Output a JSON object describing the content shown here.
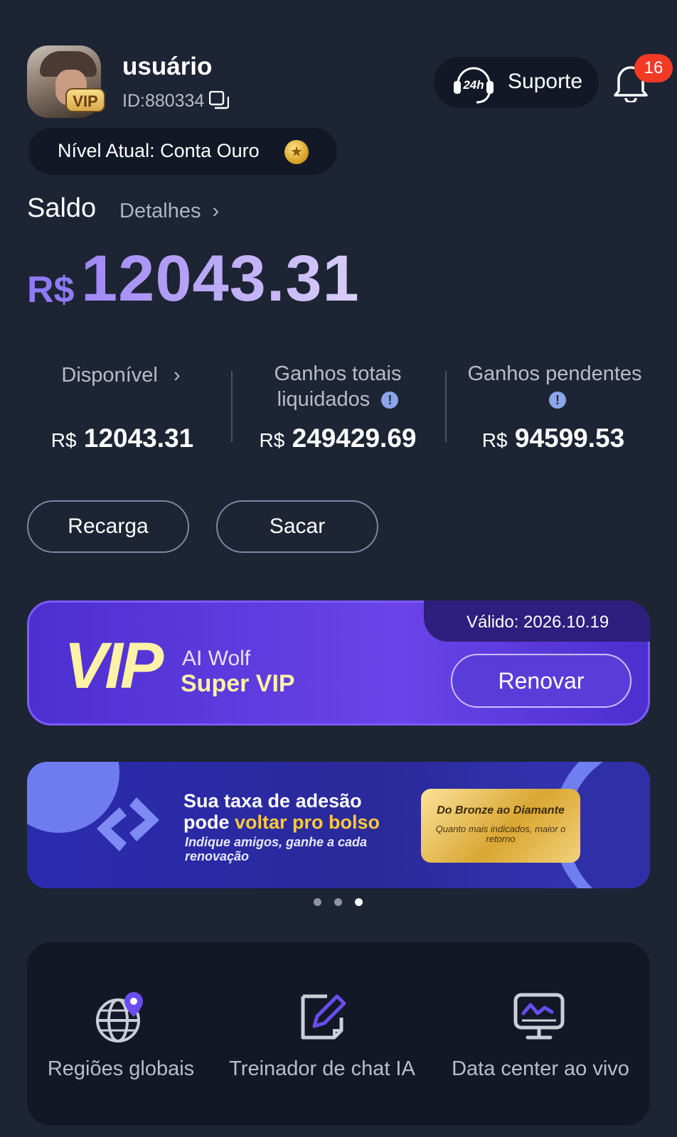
{
  "header": {
    "username": "usuário",
    "user_id": "ID:880334",
    "vip_badge": "VIP",
    "support_label": "Suporte",
    "support_icon_text": "24h",
    "notification_count": "16",
    "level_text": "Nível Atual:  Conta Ouro"
  },
  "balance": {
    "title": "Saldo",
    "details_link": "Detalhes",
    "currency": "R$",
    "amount": "12043.31"
  },
  "stats": [
    {
      "label": "Disponível",
      "currency": "R$",
      "value": "12043.31"
    },
    {
      "label": "Ganhos totais liquidados",
      "currency": "R$",
      "value": "249429.69"
    },
    {
      "label": "Ganhos pendentes",
      "currency": "R$",
      "value": "94599.53"
    }
  ],
  "actions": {
    "recharge": "Recarga",
    "withdraw": "Sacar"
  },
  "vip_card": {
    "valid_until": "Válido: 2026.10.19",
    "big": "VIP",
    "line1": "AI Wolf",
    "line2": "Super VIP",
    "renew": "Renovar"
  },
  "banner": {
    "line1": "Sua taxa de adesão",
    "line2_a": "pode ",
    "line2_b": "voltar pro bolso",
    "line3": "Indique amigos, ganhe a cada renovação",
    "gold_title": "Do Bronze ao Diamante",
    "gold_sub": "Quanto mais indicados, maior o retorno",
    "slide_index": 3,
    "slide_count": 3
  },
  "tools": [
    {
      "label": "Regiões globais",
      "icon": "globe-pin-icon"
    },
    {
      "label": "Treinador de chat IA",
      "icon": "edit-note-icon"
    },
    {
      "label": "Data center ao vivo",
      "icon": "monitor-chart-icon"
    }
  ],
  "colors": {
    "background": "#1d2433",
    "accent_purple": "#8f7af6",
    "vip_gold": "#fdf2a6",
    "badge_red": "#f23a24"
  }
}
